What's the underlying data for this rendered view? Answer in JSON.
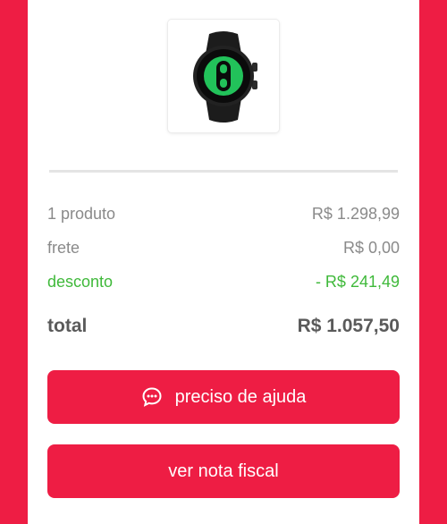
{
  "summary": {
    "products_label": "1 produto",
    "products_value": "R$ 1.298,99",
    "shipping_label": "frete",
    "shipping_value": "R$ 0,00",
    "discount_label": "desconto",
    "discount_value": "- R$ 241,49",
    "total_label": "total",
    "total_value": "R$ 1.057,50"
  },
  "actions": {
    "help_label": "preciso de ajuda",
    "invoice_label": "ver nota fiscal"
  },
  "colors": {
    "brand": "#ee1d44",
    "discount": "#3fb93a",
    "muted_text": "#8a8a8a"
  },
  "icons": {
    "help": "chat-bubble-icon",
    "product": "smartwatch-image"
  }
}
